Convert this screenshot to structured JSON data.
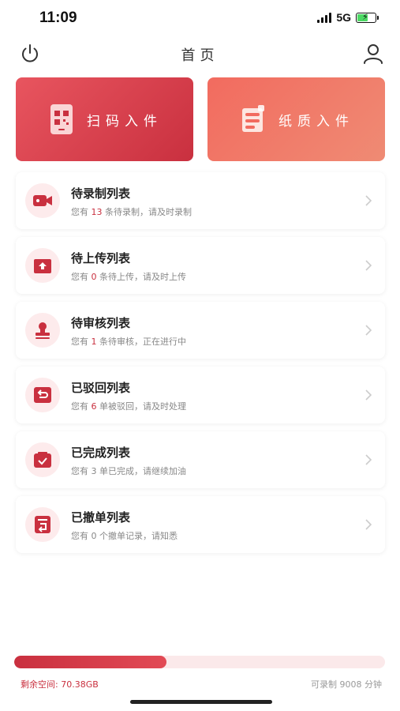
{
  "status_bar": {
    "time": "11:09",
    "network": "5G"
  },
  "nav": {
    "title": "首页"
  },
  "hero": {
    "scan_label": "扫码入件",
    "paper_label": "纸质入件"
  },
  "list": [
    {
      "title": "待录制列表",
      "sub_prefix": "您有",
      "count": "13",
      "sub_suffix": "条待录制，请及时录制",
      "icon": "video-camera-icon",
      "highlight": true
    },
    {
      "title": "待上传列表",
      "sub_prefix": "您有",
      "count": "0",
      "sub_suffix": "条待上传，请及时上传",
      "icon": "upload-box-icon",
      "highlight": true
    },
    {
      "title": "待审核列表",
      "sub_prefix": "您有",
      "count": "1",
      "sub_suffix": "条待审核，正在进行中",
      "icon": "stamp-icon",
      "highlight": true
    },
    {
      "title": "已驳回列表",
      "sub_prefix": "您有",
      "count": "6",
      "sub_suffix": "单被驳回，请及时处理",
      "icon": "return-icon",
      "highlight": true
    },
    {
      "title": "已完成列表",
      "sub_prefix": "您有",
      "count": "3",
      "sub_suffix": "单已完成，请继续加油",
      "icon": "check-box-icon",
      "highlight": false
    },
    {
      "title": "已撤单列表",
      "sub_prefix": "您有",
      "count": "0",
      "sub_suffix": "个撤单记录，请知悉",
      "icon": "undo-document-icon",
      "highlight": false
    }
  ],
  "storage": {
    "used_fraction": 0.41,
    "free_label": "剩余空间: 70.38GB",
    "record_label": "可录制 9008 分钟"
  },
  "colors": {
    "accent": "#c9303f",
    "accent_light": "#fdebec",
    "paper_button": "#f26b5f"
  }
}
